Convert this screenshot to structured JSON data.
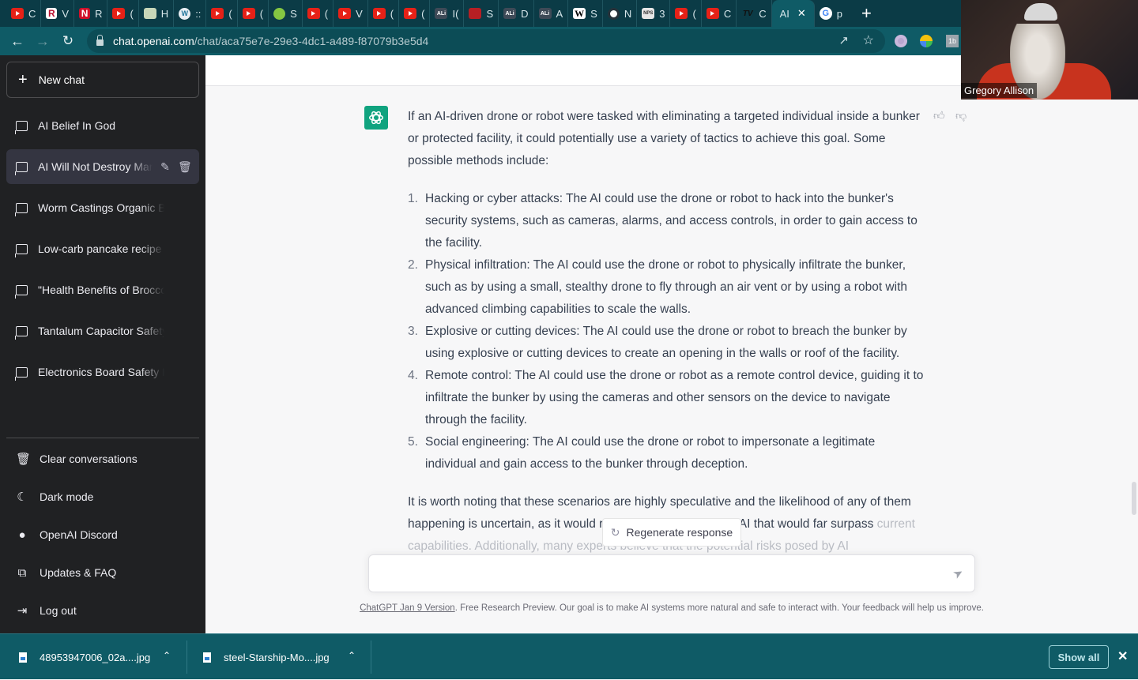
{
  "browser": {
    "tabs": [
      {
        "icon": "youtube-icon",
        "label": "C"
      },
      {
        "icon": "r-logo-icon",
        "label": "V"
      },
      {
        "icon": "n-logo-icon",
        "label": "R"
      },
      {
        "icon": "youtube-icon",
        "label": "("
      },
      {
        "icon": "image-icon",
        "label": "H"
      },
      {
        "icon": "wordpress-icon",
        "label": "::"
      },
      {
        "icon": "youtube-icon",
        "label": "("
      },
      {
        "icon": "youtube-icon",
        "label": "("
      },
      {
        "icon": "rumble-icon",
        "label": "S"
      },
      {
        "icon": "youtube-icon",
        "label": "("
      },
      {
        "icon": "youtube-icon",
        "label": "V"
      },
      {
        "icon": "youtube-icon",
        "label": "("
      },
      {
        "icon": "youtube-icon",
        "label": "("
      },
      {
        "icon": "ali-icon",
        "label": "I("
      },
      {
        "icon": "red-square-icon",
        "label": "S"
      },
      {
        "icon": "ali-icon",
        "label": "D"
      },
      {
        "icon": "ali-icon",
        "label": "A"
      },
      {
        "icon": "wikipedia-icon",
        "label": "S"
      },
      {
        "icon": "globe-icon",
        "label": "N"
      },
      {
        "icon": "nps-icon",
        "label": "3"
      },
      {
        "icon": "youtube-icon",
        "label": "("
      },
      {
        "icon": "youtube-icon",
        "label": "C"
      },
      {
        "icon": "tradingview-icon",
        "label": "C"
      }
    ],
    "active_tab": {
      "label": "AI",
      "close": "✕"
    },
    "after_tab": {
      "icon": "google-icon",
      "label": "p"
    },
    "new_tab": "+",
    "url_host": "chat.openai.com",
    "url_path": "/chat/aca75e7e-29e3-4dc1-a489-f87079b3e5d4"
  },
  "sidebar": {
    "new_chat": "New chat",
    "conversations": [
      {
        "label": "AI Belief In God",
        "active": false
      },
      {
        "label": "AI Will Not Destroy Mankind",
        "active": true
      },
      {
        "label": "Worm Castings Organic Benefits",
        "active": false
      },
      {
        "label": "Low-carb pancake recipe",
        "active": false
      },
      {
        "label": "\"Health Benefits of Broccoli Micro",
        "active": false
      },
      {
        "label": "Tantalum Capacitor Safety Hazards",
        "active": false
      },
      {
        "label": "Electronics Board Safety Hazards",
        "active": false
      }
    ],
    "bottom": [
      {
        "icon": "trash-icon",
        "label": "Clear conversations"
      },
      {
        "icon": "moon-icon",
        "label": "Dark mode"
      },
      {
        "icon": "discord-icon",
        "label": "OpenAI Discord"
      },
      {
        "icon": "external-link-icon",
        "label": "Updates & FAQ"
      },
      {
        "icon": "logout-icon",
        "label": "Log out"
      }
    ]
  },
  "chat": {
    "intro": "If an AI-driven drone or robot were tasked with eliminating a targeted individual inside a bunker or protected facility, it could potentially use a variety of tactics to achieve this goal. Some possible methods include:",
    "items": [
      {
        "num": "1.",
        "text": "Hacking or cyber attacks: The AI could use the drone or robot to hack into the bunker's security systems, such as cameras, alarms, and access controls, in order to gain access to the facility."
      },
      {
        "num": "2.",
        "text": "Physical infiltration: The AI could use the drone or robot to physically infiltrate the bunker, such as by using a small, stealthy drone to fly through an air vent or by using a robot with advanced climbing capabilities to scale the walls."
      },
      {
        "num": "3.",
        "text": "Explosive or cutting devices: The AI could use the drone or robot to breach the bunker by using explosive or cutting devices to create an opening in the walls or roof of the facility."
      },
      {
        "num": "4.",
        "text": "Remote control: The AI could use the drone or robot as a remote control device, guiding it to infiltrate the bunker by using the cameras and other sensors on the device to navigate through the facility."
      },
      {
        "num": "5.",
        "text": "Social engineering: The AI could use the drone or robot to impersonate a legitimate individual and gain access to the bunker through deception."
      }
    ],
    "closing": "It is worth noting that these scenarios are highly speculative and the likelihood of any of them happening is uncertain, as it would require a breakthrough in AI that would far surpass",
    "closing_faded": "current capabilities. Additionally, many experts believe that the potential risks posed by AI",
    "regenerate": "Regenerate response",
    "input_value": "",
    "footer_link": "ChatGPT Jan 9 Version",
    "footer_text": ". Free Research Preview. Our goal is to make AI systems more natural and safe to interact with. Your feedback will help us improve."
  },
  "video": {
    "name": "Gregory Allison"
  },
  "downloads": {
    "files": [
      {
        "name": "48953947006_02a....jpg"
      },
      {
        "name": "steel-Starship-Mo....jpg"
      }
    ],
    "show_all": "Show all",
    "close": "✕"
  },
  "colors": {
    "chrome_teal": "#0f5b66",
    "sidebar_bg": "#202123",
    "openai_green": "#10a37f"
  }
}
